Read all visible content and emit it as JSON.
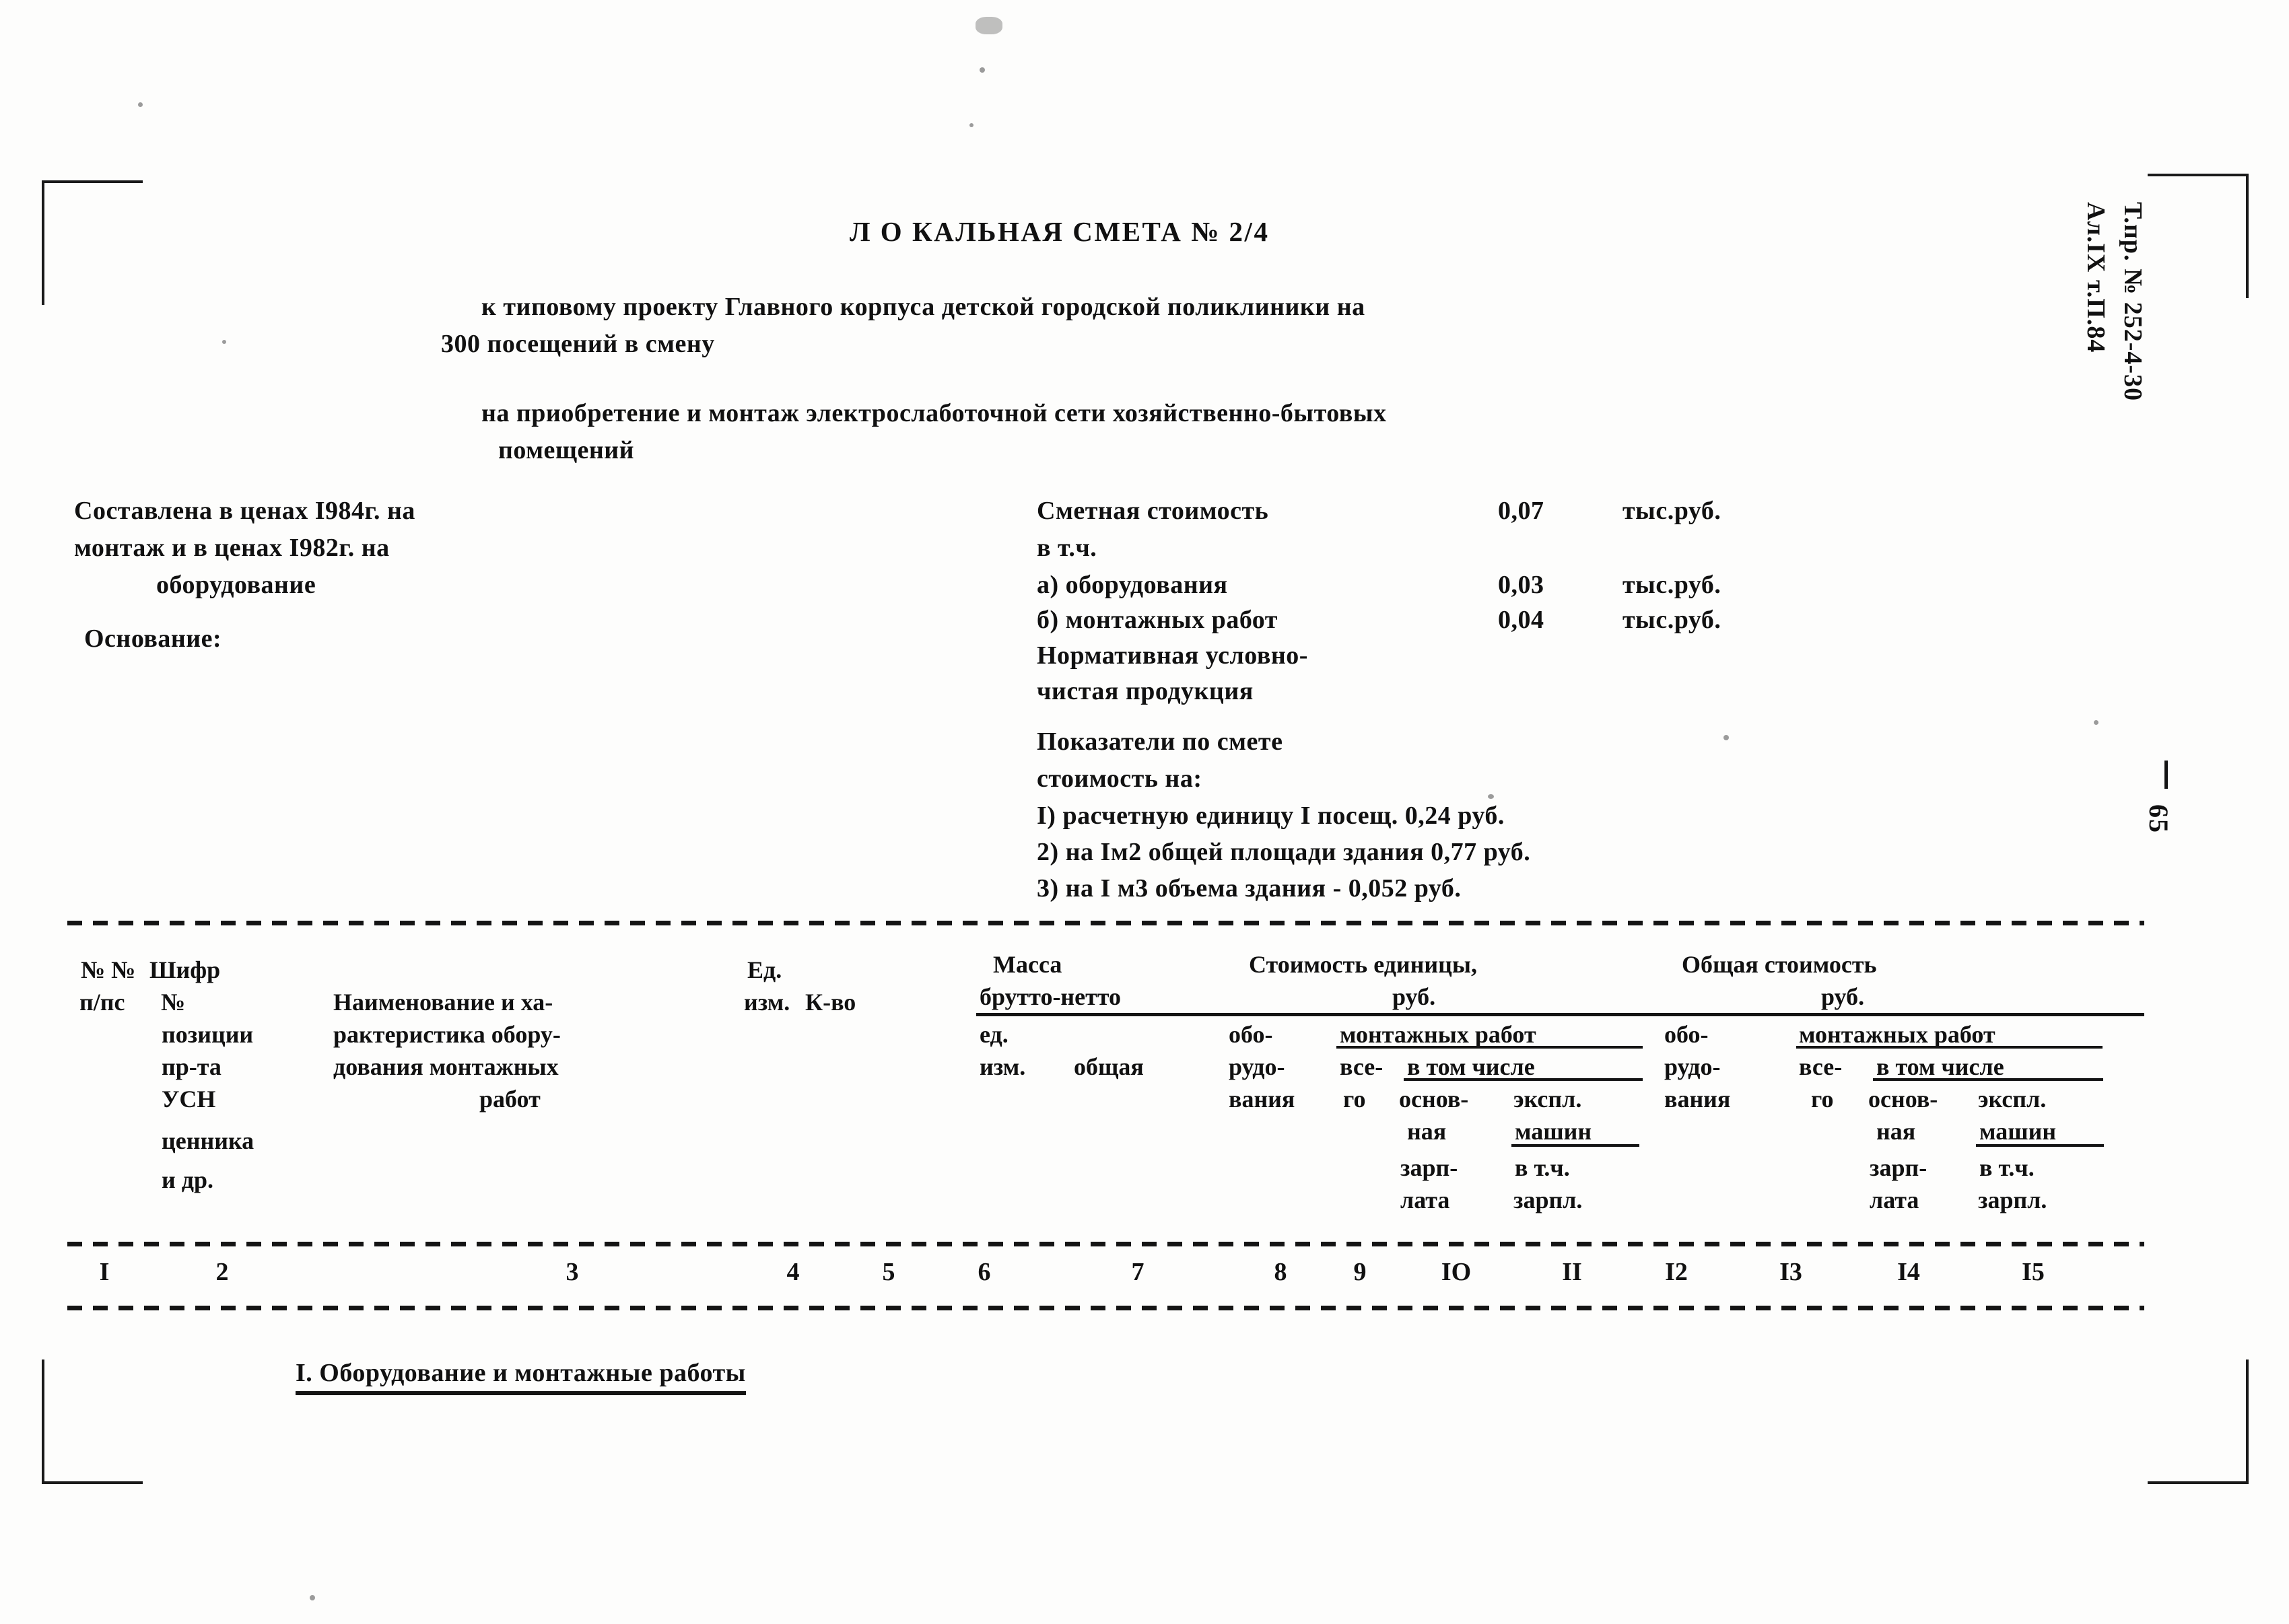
{
  "document": {
    "title": "Л О КАЛЬНАЯ СМЕТА № 2/4",
    "subtitle_line1": "к типовому проекту Главного корпуса детской городской поликлиники на",
    "subtitle_line2": "300 посещений в смену",
    "purpose_line1": "на приобретение и монтаж электрослаботочной сети хозяйственно-бытовых",
    "purpose_line2": "помещений"
  },
  "left_block": {
    "prices_line1": "Составлена в ценах I984г. на",
    "prices_line2": "монтаж и в ценах I982г. на",
    "prices_line3": "оборудование",
    "basis_label": "Основание:"
  },
  "cost_block": {
    "total_label": "Сметная стоимость",
    "total_value": "0,07",
    "total_unit": "тыс.руб.",
    "including_label": "в т.ч.",
    "equipment_label": "а) оборудования",
    "equipment_value": "0,03",
    "equipment_unit": "тыс.руб.",
    "install_label": "б) монтажных работ",
    "install_value": "0,04",
    "install_unit": "тыс.руб.",
    "normative_line1": "Нормативная условно-",
    "normative_line2": "чистая продукция"
  },
  "indicators": {
    "heading_line1": "Показатели по смете",
    "heading_line2": "стоимость на:",
    "items": [
      "I) расчетную единицу I посещ. 0,24 руб.",
      "2) на Iм2 общей площади здания 0,77 руб.",
      "3) на I м3 объема здания - 0,052 руб."
    ]
  },
  "table": {
    "headers": {
      "col1_line1": "№ №",
      "col1_line2": "п/пс",
      "col2_line1": "Шифр",
      "col2_line2": "№",
      "col2_line3": "позиции",
      "col2_line4": "пр-та",
      "col2_line5": "УСН",
      "col2_line6": "ценника",
      "col2_line7": "и др.",
      "col3_line1": "Наименование и ха-",
      "col3_line2": "рактеристика обору-",
      "col3_line3": "дования монтажных",
      "col3_line4": "работ",
      "col4_line1": "Ед.",
      "col4_line2": "изм.",
      "col5": "К-во",
      "mass_title": "Масса",
      "mass_subtitle": "брутто-нетто",
      "mass_col6": "ед.",
      "mass_col6b": "изм.",
      "mass_col7": "общая",
      "unit_cost_title": "Стоимость единицы,",
      "unit_cost_unit": "руб.",
      "total_cost_title": "Общая стоимость",
      "total_cost_unit": "руб.",
      "equipment_l1": "обо-",
      "equipment_l2": "рудо-",
      "equipment_l3": "вания",
      "install_works": "монтажных работ",
      "all_l1": "все-",
      "all_l2": "го",
      "in_which": "в том числе",
      "basic_l1": "основ-",
      "basic_l2": "ная",
      "basic_l3": "зарп-",
      "basic_l4": "лата",
      "expl_l1": "экспл.",
      "expl_l2": "машин",
      "expl_l3": "в т.ч.",
      "expl_l4": "зарпл."
    },
    "column_numbers": [
      "I",
      "2",
      "3",
      "4",
      "5",
      "6",
      "7",
      "8",
      "9",
      "IO",
      "II",
      "I2",
      "I3",
      "I4",
      "I5"
    ]
  },
  "section": {
    "title": "I. Оборудование и монтажные работы"
  },
  "margin": {
    "project_code_line1": "Т.пр. № 252-4-30",
    "project_code_line2": "Ал.IX т.П.84",
    "page_number": "65"
  }
}
